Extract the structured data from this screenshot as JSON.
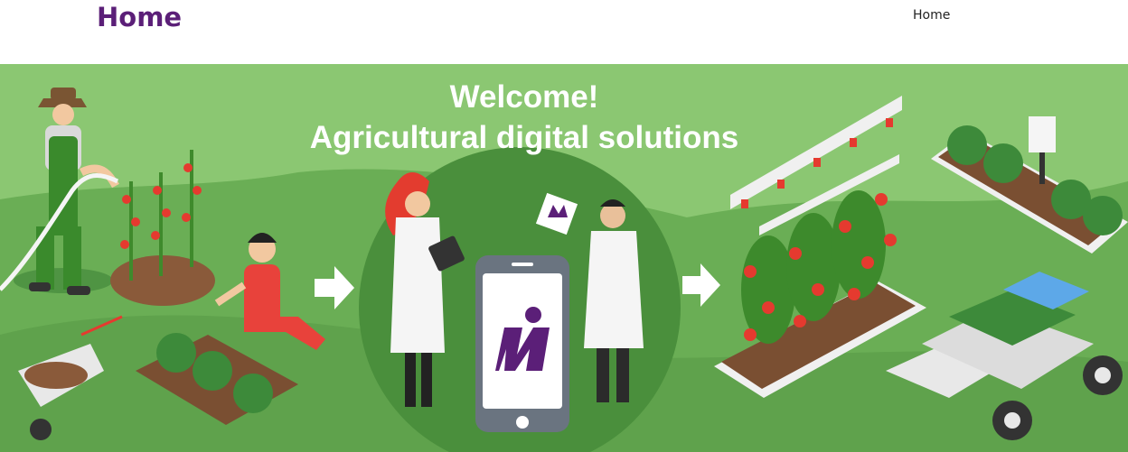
{
  "header": {
    "brand": "Home",
    "nav": [
      {
        "label": "Home"
      }
    ]
  },
  "hero": {
    "title_line1": "Welcome!",
    "title_line2": "Agricultural digital solutions"
  },
  "colors": {
    "brand": "#5b1f78",
    "hero_green": "#6fb25a",
    "hero_dark_green": "#3f8a3a"
  },
  "icons": [
    "arrow-right-icon",
    "arrow-right-icon",
    "app-logo-icon"
  ]
}
